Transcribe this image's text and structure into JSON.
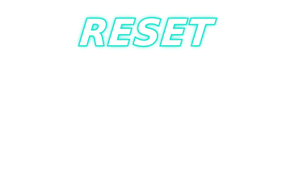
{
  "reset_button": {
    "label": "RESET"
  },
  "colors": {
    "text_fill": "#ffffff",
    "outline": "#14e0c8",
    "background": "#ffffff"
  }
}
